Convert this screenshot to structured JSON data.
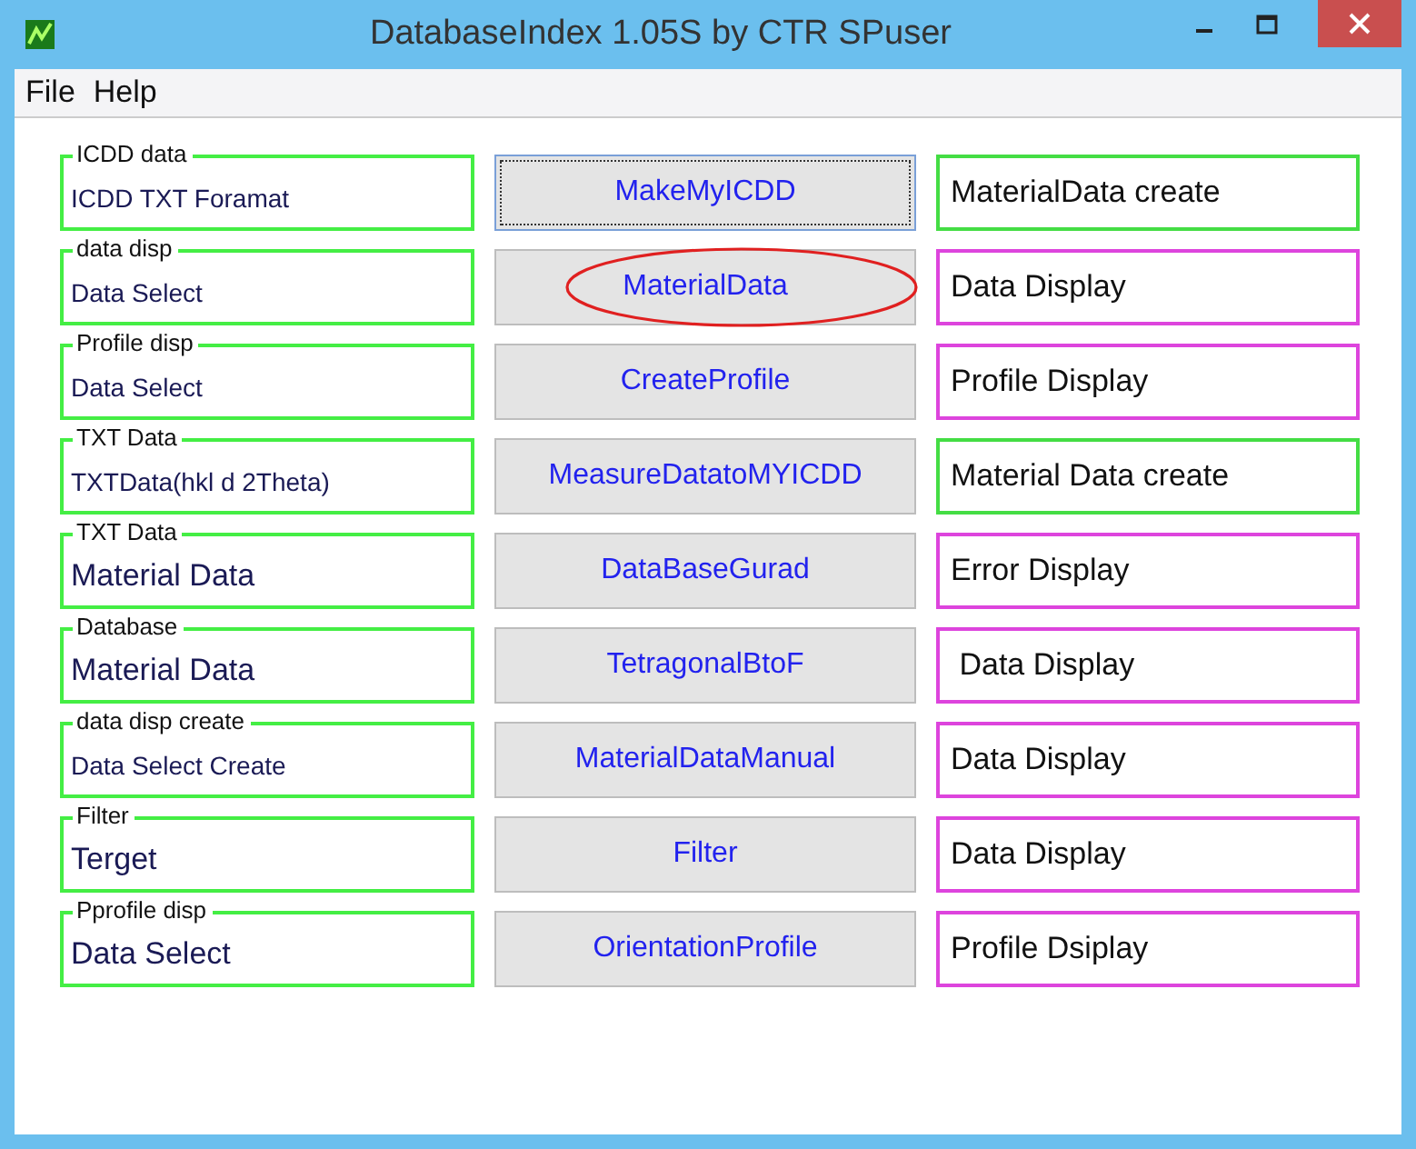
{
  "window": {
    "title": "DatabaseIndex 1.05S by CTR SPuser"
  },
  "menu": [
    "File",
    "Help"
  ],
  "rows": [
    {
      "group": "ICDD data",
      "value": "ICDD TXT Foramat",
      "kind": "small",
      "button": "MakeMyICDD",
      "focused": true,
      "circled": false,
      "result": "MaterialData create",
      "color": "#44dd44"
    },
    {
      "group": "data disp",
      "value": "Data Select",
      "kind": "small",
      "button": "MaterialData",
      "focused": false,
      "circled": true,
      "result": "Data Display",
      "color": "#dd44dd"
    },
    {
      "group": "Profile disp",
      "value": "Data Select",
      "kind": "small",
      "button": "CreateProfile",
      "focused": false,
      "circled": false,
      "result": "Profile Display",
      "color": "#dd44dd"
    },
    {
      "group": "TXT Data",
      "value": "TXTData(hkl d 2Theta)",
      "kind": "small",
      "button": "MeasureDatatoMYICDD",
      "focused": false,
      "circled": false,
      "result": "Material Data create",
      "color": "#44dd44"
    },
    {
      "group": "TXT Data",
      "value": "Material Data",
      "kind": "large",
      "button": "DataBaseGurad",
      "focused": false,
      "circled": false,
      "result": "Error Display",
      "color": "#dd44dd"
    },
    {
      "group": "Database",
      "value": "Material Data",
      "kind": "large",
      "button": "TetragonalBtoF",
      "focused": false,
      "circled": false,
      "result": " Data Display",
      "color": "#dd44dd"
    },
    {
      "group": "data disp create",
      "value": "Data Select Create",
      "kind": "small",
      "button": "MaterialDataManual",
      "focused": false,
      "circled": false,
      "result": "Data Display",
      "color": "#dd44dd"
    },
    {
      "group": "Filter",
      "value": "Terget",
      "kind": "large",
      "button": "Filter",
      "focused": false,
      "circled": false,
      "result": "Data Display",
      "color": "#dd44dd"
    },
    {
      "group": "Pprofile disp",
      "value": "Data Select",
      "kind": "large",
      "button": "OrientationProfile",
      "focused": false,
      "circled": false,
      "result": "Profile Dsiplay",
      "color": "#dd44dd"
    }
  ]
}
